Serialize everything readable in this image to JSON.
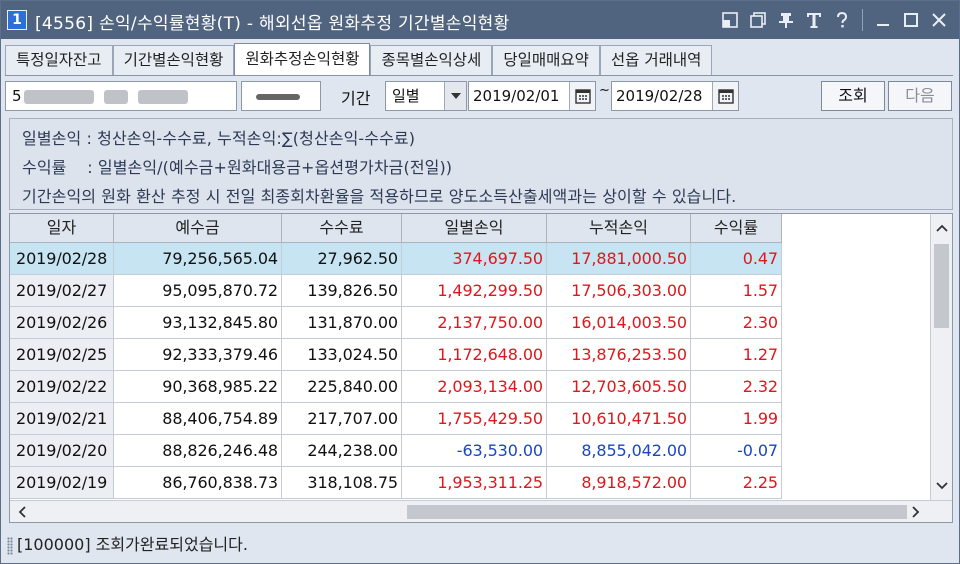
{
  "window": {
    "number": "1",
    "title": "[4556] 손익/수익률현황(T) - 해외선옵 원화추정 기간별손익현황"
  },
  "tabs": [
    {
      "label": "특정일자잔고",
      "active": false
    },
    {
      "label": "기간별손익현황",
      "active": false
    },
    {
      "label": "원화추정손익현황",
      "active": true
    },
    {
      "label": "종목별손익상세",
      "active": false
    },
    {
      "label": "당일매매요약",
      "active": false
    },
    {
      "label": "선옵 거래내역",
      "active": false
    }
  ],
  "query": {
    "account_prefix": "5",
    "period_label": "기간",
    "period_value": "일별",
    "date_from": "2019/02/01",
    "date_sep": "~",
    "date_to": "2019/02/28",
    "search_label": "조회",
    "next_label": "다음"
  },
  "info": {
    "line1": "일별손익 : 청산손익-수수료, 누적손익:∑(청산손익-수수료)",
    "line2": "수익률    : 일별손익/(예수금+원화대용금+옵션평가차금(전일))",
    "line3": "기간손익의 원화 환산 추정 시 전일 최종회차환율을 적용하므로 양도소득산출세액과는 상이할 수 있습니다."
  },
  "grid": {
    "columns": [
      "일자",
      "예수금",
      "수수료",
      "일별손익",
      "누적손익",
      "수익률"
    ],
    "rows": [
      {
        "date": "2019/02/28",
        "deposit": "79,256,565.04",
        "fee": "27,962.50",
        "daily": "374,697.50",
        "cum": "17,881,000.50",
        "rate": "0.47",
        "sign": "pos",
        "selected": true
      },
      {
        "date": "2019/02/27",
        "deposit": "95,095,870.72",
        "fee": "139,826.50",
        "daily": "1,492,299.50",
        "cum": "17,506,303.00",
        "rate": "1.57",
        "sign": "pos",
        "selected": false
      },
      {
        "date": "2019/02/26",
        "deposit": "93,132,845.80",
        "fee": "131,870.00",
        "daily": "2,137,750.00",
        "cum": "16,014,003.50",
        "rate": "2.30",
        "sign": "pos",
        "selected": false
      },
      {
        "date": "2019/02/25",
        "deposit": "92,333,379.46",
        "fee": "133,024.50",
        "daily": "1,172,648.00",
        "cum": "13,876,253.50",
        "rate": "1.27",
        "sign": "pos",
        "selected": false
      },
      {
        "date": "2019/02/22",
        "deposit": "90,368,985.22",
        "fee": "225,840.00",
        "daily": "2,093,134.00",
        "cum": "12,703,605.50",
        "rate": "2.32",
        "sign": "pos",
        "selected": false
      },
      {
        "date": "2019/02/21",
        "deposit": "88,406,754.89",
        "fee": "217,707.00",
        "daily": "1,755,429.50",
        "cum": "10,610,471.50",
        "rate": "1.99",
        "sign": "pos",
        "selected": false
      },
      {
        "date": "2019/02/20",
        "deposit": "88,826,246.48",
        "fee": "244,238.00",
        "daily": "-63,530.00",
        "cum": "8,855,042.00",
        "rate": "-0.07",
        "sign": "neg",
        "selected": false
      },
      {
        "date": "2019/02/19",
        "deposit": "86,760,838.73",
        "fee": "318,108.75",
        "daily": "1,953,311.25",
        "cum": "8,918,572.00",
        "rate": "2.25",
        "sign": "pos",
        "selected": false
      }
    ]
  },
  "status": {
    "message": "[100000] 조회가완료되었습니다."
  },
  "colors": {
    "titlebar": "#51647f",
    "positive": "#e0161c",
    "negative": "#1a46c2",
    "selected_row": "#c6e4f1"
  }
}
